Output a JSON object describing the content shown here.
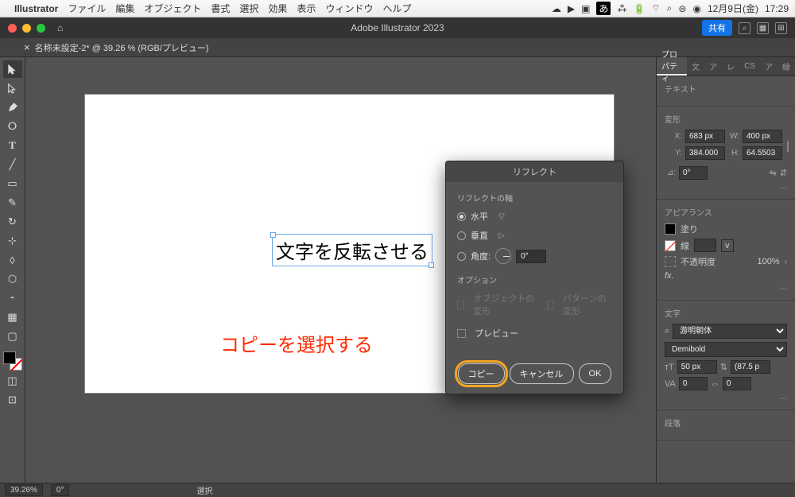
{
  "menubar": {
    "app": "Illustrator",
    "items": [
      "ファイル",
      "編集",
      "オブジェクト",
      "書式",
      "選択",
      "効果",
      "表示",
      "ウィンドウ",
      "ヘルプ"
    ],
    "date": "12月9日(金)",
    "time": "17:29"
  },
  "titlebar": {
    "title": "Adobe Illustrator 2023",
    "share": "共有"
  },
  "tab": {
    "label": "名称未設定-2* @ 39.26 % (RGB/プレビュー)"
  },
  "canvas": {
    "text": "文字を反転させる",
    "annotation": "コピーを選択する"
  },
  "dialog": {
    "title": "リフレクト",
    "axis_label": "リフレクトの軸",
    "horizontal": "水平",
    "vertical": "垂直",
    "angle_label": "角度:",
    "angle_value": "0°",
    "options_label": "オプション",
    "transform_objects": "オブジェクトの変形",
    "transform_patterns": "パターンの変形",
    "preview": "プレビュー",
    "btn_copy": "コピー",
    "btn_cancel": "キャンセル",
    "btn_ok": "OK"
  },
  "properties": {
    "tabs": [
      "プロパティ",
      "文",
      "ア",
      "レ",
      "CS",
      "ア",
      "線"
    ],
    "section_text": "テキスト",
    "section_transform": "変形",
    "x_label": "X:",
    "x_value": "683 px",
    "y_label": "Y:",
    "y_value": "384.000",
    "w_label": "W:",
    "w_value": "400 px",
    "h_label": "H:",
    "h_value": "64.5503",
    "angle_label": "⊿:",
    "angle_value": "0°",
    "section_appearance": "アピアランス",
    "fill": "塗り",
    "stroke": "線",
    "opacity_label": "不透明度",
    "opacity_value": "100%",
    "fx": "fx.",
    "section_character": "文字",
    "font_family": "游明朝体",
    "font_style": "Demibold",
    "font_size": "50 px",
    "leading": "(87.5 p",
    "tracking1": "0",
    "tracking2": "0",
    "section_paragraph": "段落"
  },
  "statusbar": {
    "zoom": "39.26%",
    "rotation": "0°",
    "tool": "選択"
  }
}
